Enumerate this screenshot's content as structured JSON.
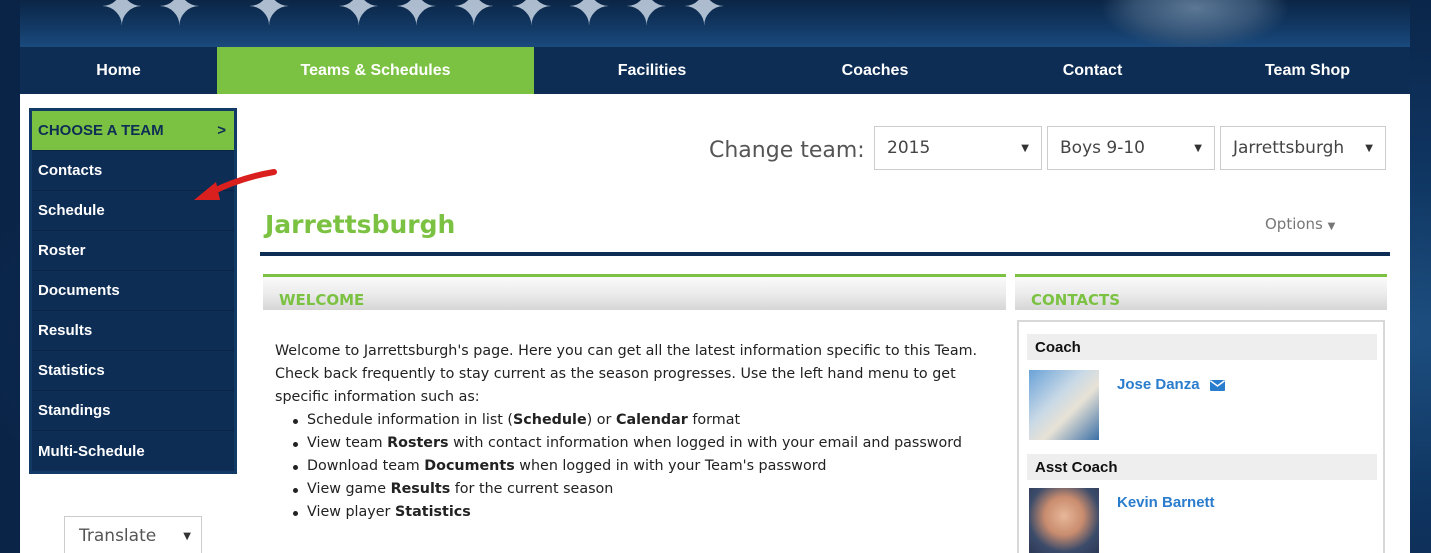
{
  "nav": {
    "items": [
      {
        "label": "Home",
        "active": false
      },
      {
        "label": "Teams & Schedules",
        "active": true
      },
      {
        "label": "Facilities",
        "active": false
      },
      {
        "label": "Coaches",
        "active": false
      },
      {
        "label": "Contact",
        "active": false
      },
      {
        "label": "Team Shop",
        "active": false
      }
    ]
  },
  "sidebar": {
    "header": "CHOOSE A TEAM",
    "header_chevron": ">",
    "items": [
      "Contacts",
      "Schedule",
      "Roster",
      "Documents",
      "Results",
      "Statistics",
      "Standings",
      "Multi-Schedule"
    ]
  },
  "translate": {
    "label": "Translate"
  },
  "team_selector": {
    "label": "Change team:",
    "year": "2015",
    "division": "Boys 9-10",
    "team": "Jarrettsburgh"
  },
  "page": {
    "title": "Jarrettsburgh",
    "options_label": "Options"
  },
  "welcome": {
    "heading": "WELCOME",
    "intro": "Welcome to Jarrettsburgh's page. Here you can get all the latest information specific to this Team. Check back frequently to stay current as the season progresses. Use the left hand menu to get specific information such as:",
    "bullets": [
      {
        "pre": "Schedule information in list (",
        "b1": "Schedule",
        "mid": ") or ",
        "b2": "Calendar",
        "post": " format"
      },
      {
        "pre": "View team ",
        "b1": "Rosters",
        "post": " with contact information when logged in with your email and password"
      },
      {
        "pre": "Download team ",
        "b1": "Documents",
        "post": " when logged in with your Team's password"
      },
      {
        "pre": "View game ",
        "b1": "Results",
        "post": " for the current season"
      },
      {
        "pre": "View player ",
        "b1": "Statistics",
        "post": ""
      }
    ]
  },
  "contacts": {
    "heading": "CONTACTS",
    "groups": [
      {
        "role": "Coach",
        "name": "Jose Danza"
      },
      {
        "role": "Asst Coach",
        "name": "Kevin Barnett"
      }
    ]
  },
  "colors": {
    "navy": "#0d2d55",
    "green": "#7cc242",
    "link_blue": "#2a7ccd",
    "arrow_red": "#d9201f"
  }
}
